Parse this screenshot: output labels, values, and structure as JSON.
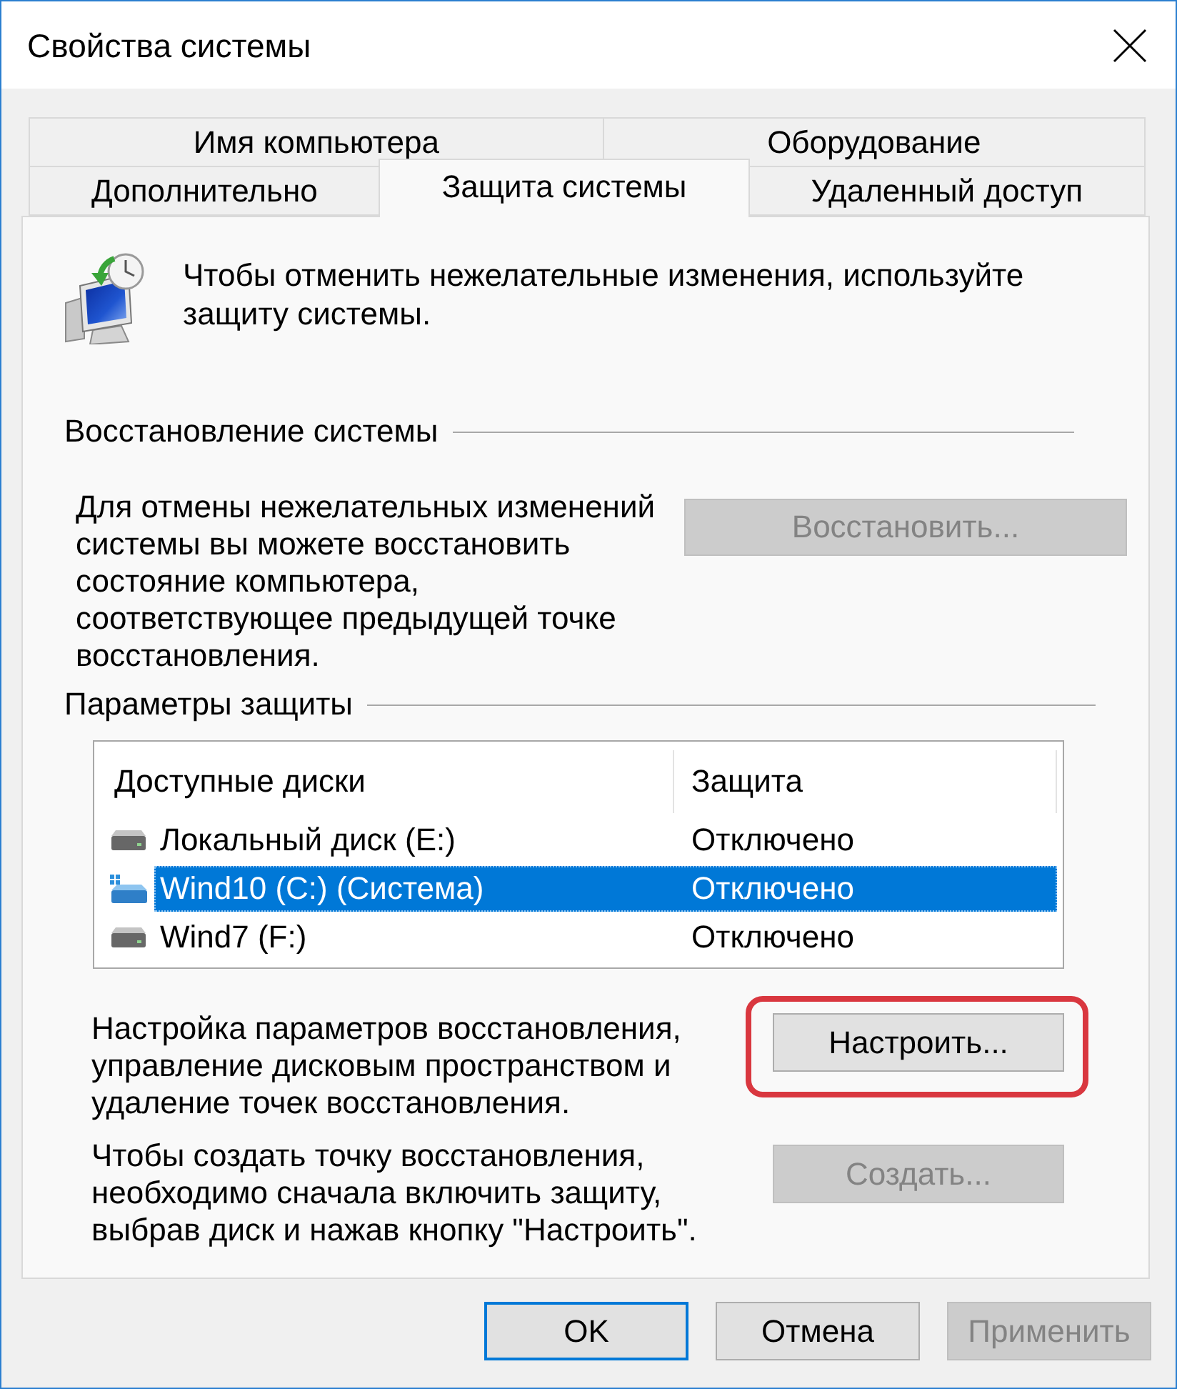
{
  "window": {
    "title": "Свойства системы"
  },
  "tab_rows": [
    {
      "tabs": [
        {
          "label": "Имя компьютера",
          "selected": false
        },
        {
          "label": "Оборудование",
          "selected": false
        }
      ]
    },
    {
      "tabs": [
        {
          "label": "Дополнительно",
          "selected": false
        },
        {
          "label": "Защита системы",
          "selected": true
        },
        {
          "label": "Удаленный доступ",
          "selected": false
        }
      ]
    }
  ],
  "intro": "Чтобы отменить нежелательные изменения, используйте защиту системы.",
  "restore": {
    "title": "Восстановление системы",
    "text": "Для отмены нежелательных изменений системы вы можете восстановить состояние компьютера, соответствующее предыдущей точке восстановления.",
    "button": {
      "label": "Восстановить...",
      "disabled": true
    }
  },
  "protection": {
    "title": "Параметры защиты",
    "columns": [
      "Доступные диски",
      "Защита"
    ],
    "drives": [
      {
        "name": "Локальный диск (E:)",
        "status": "Отключено",
        "kind": "drive",
        "selected": false
      },
      {
        "name": "Wind10 (C:) (Система)",
        "status": "Отключено",
        "kind": "system",
        "selected": true
      },
      {
        "name": "Wind7 (F:)",
        "status": "Отключено",
        "kind": "drive",
        "selected": false
      }
    ],
    "configure": {
      "text": "Настройка параметров восстановления, управление дисковым пространством и удаление точек восстановления.",
      "button": {
        "label": "Настроить...",
        "disabled": false,
        "highlighted": true
      }
    },
    "create": {
      "text": "Чтобы создать точку восстановления, необходимо сначала включить защиту, выбрав диск и нажав кнопку \"Настроить\".",
      "button": {
        "label": "Создать...",
        "disabled": true
      }
    }
  },
  "buttons": [
    {
      "label": "OK",
      "default": true,
      "disabled": false
    },
    {
      "label": "Отмена",
      "default": false,
      "disabled": false
    },
    {
      "label": "Применить",
      "default": false,
      "disabled": true
    }
  ]
}
